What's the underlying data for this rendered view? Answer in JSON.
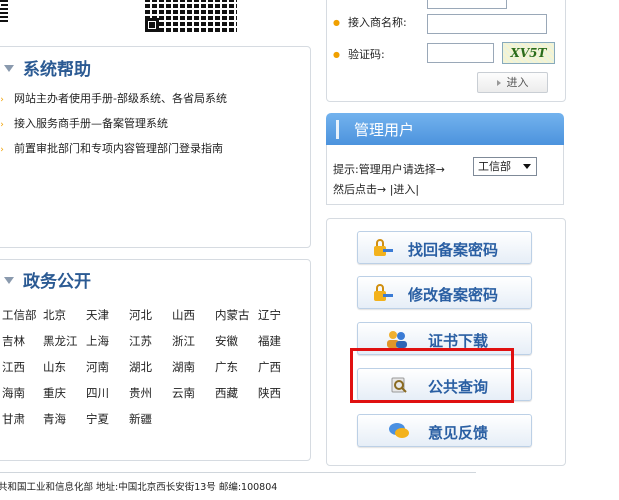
{
  "help": {
    "title": "系统帮助",
    "items": [
      "网站主办者使用手册-部级系统、各省局系统",
      "接入服务商手册—备案管理系统",
      "前置审批部门和专项内容管理部门登录指南"
    ]
  },
  "gov": {
    "title": "政务公开",
    "rows": [
      [
        "工信部",
        "北京",
        "天津",
        "河北",
        "山西",
        "内蒙古",
        "辽宁"
      ],
      [
        "吉林",
        "黑龙江",
        "上海",
        "江苏",
        "浙江",
        "安徽",
        "福建"
      ],
      [
        "江西",
        "山东",
        "河南",
        "湖北",
        "湖南",
        "广东",
        "广西"
      ],
      [
        "海南",
        "重庆",
        "四川",
        "贵州",
        "云南",
        "西藏",
        "陕西"
      ],
      [
        "甘肃",
        "青海",
        "宁夏",
        "新疆"
      ]
    ]
  },
  "login": {
    "provider_label": "接入商名称:",
    "captcha_label": "验证码:",
    "captcha_text": "XV5T",
    "enter_label": "进入"
  },
  "admin": {
    "title": "管理用户",
    "hint": "提示:管理用户请选择→",
    "select_value": "工信部",
    "then": "然后点击→ |进入|"
  },
  "actions": [
    {
      "label": "找回备案密码",
      "icon": "key-lock-icon"
    },
    {
      "label": "修改备案密码",
      "icon": "key-lock-icon"
    },
    {
      "label": "证书下载",
      "icon": "users-icon"
    },
    {
      "label": "公共查询",
      "icon": "search-query-icon"
    },
    {
      "label": "意见反馈",
      "icon": "chat-bubble-icon"
    }
  ],
  "footer": {
    "text": "共和国工业和信息化部 地址:中国北京西长安街13号 邮编:100804"
  },
  "colors": {
    "title_blue": "#2b5a93",
    "header_blue": "#4c93dd",
    "highlight_red": "#e01010",
    "bullet_orange": "#f0a000"
  }
}
